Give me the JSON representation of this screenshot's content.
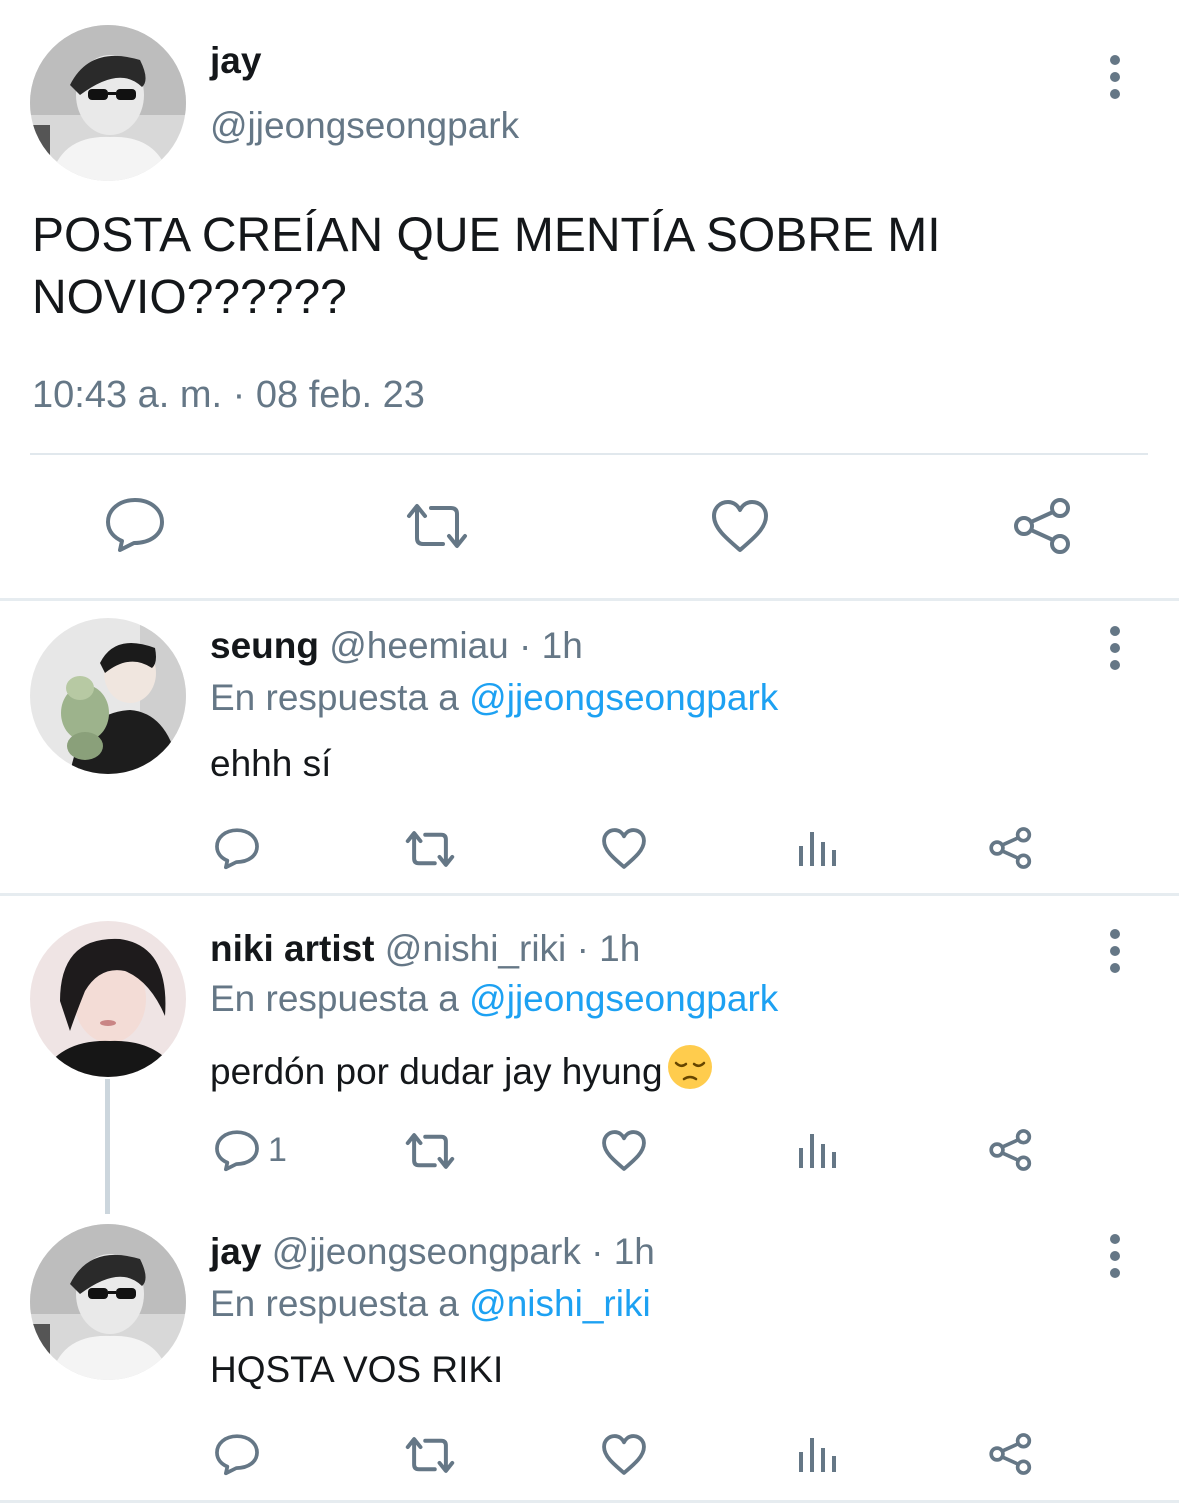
{
  "main": {
    "name": "jay",
    "handle": "@jjeongseongpark",
    "text": "POSTA CREÍAN QUE MENTÍA SOBRE MI NOVIO??????",
    "timestamp": "10:43 a. m. · 08 feb. 23",
    "actions": [
      "reply-icon",
      "retweet-icon",
      "like-icon",
      "share-icon"
    ]
  },
  "replies": [
    {
      "name": "seung",
      "handle": "@heemiau",
      "time": "· 1h",
      "in_reply_prefix": "En respuesta a ",
      "in_reply_to": "@jjeongseongpark",
      "text": "ehhh sí",
      "reply_count": ""
    },
    {
      "name": "niki artist",
      "handle": "@nishi_riki",
      "time": "· 1h",
      "in_reply_prefix": "En respuesta a ",
      "in_reply_to": "@jjeongseongpark",
      "text": "perdón por dudar jay hyung",
      "emoji": "pensive-face",
      "reply_count": "1"
    },
    {
      "name": "jay",
      "handle": "@jjeongseongpark",
      "time": "· 1h",
      "in_reply_prefix": "En respuesta a ",
      "in_reply_to": "@nishi_riki",
      "text": "HQSTA VOS RIKI",
      "reply_count": ""
    }
  ],
  "colors": {
    "text": "#14171a",
    "secondary": "#657786",
    "link": "#1da1f2",
    "divider": "#e6ecf0"
  }
}
